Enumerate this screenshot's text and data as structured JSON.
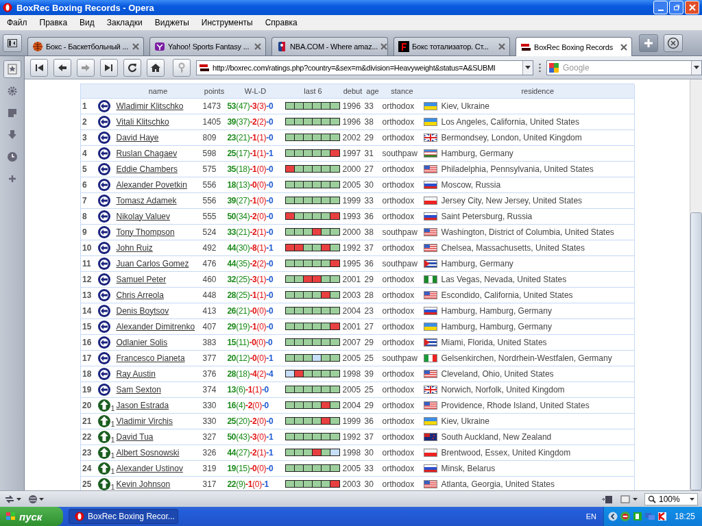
{
  "window": {
    "title": "BoxRec Boxing Records - Opera"
  },
  "menu": [
    "Файл",
    "Правка",
    "Вид",
    "Закладки",
    "Виджеты",
    "Инструменты",
    "Справка"
  ],
  "tabs": [
    {
      "label": "Бокс - Баскетбольный ...",
      "kind": "ball",
      "selected": false
    },
    {
      "label": "Yahoo! Sports Fantasy ...",
      "kind": "yahoo",
      "selected": false
    },
    {
      "label": "NBA.COM - Where amaz...",
      "kind": "nba",
      "selected": false
    },
    {
      "label": "Бокс тотализатор. Ст...",
      "kind": "f",
      "selected": false
    },
    {
      "label": "BoxRec Boxing Records",
      "kind": "boxrec",
      "selected": true
    }
  ],
  "address": {
    "value": "http://boxrec.com/ratings.php?country=&sex=m&division=Heavyweight&status=A&SUBMI"
  },
  "search": {
    "placeholder": "Google"
  },
  "table": {
    "columns": [
      "name",
      "points",
      "W-L-D",
      "last 6",
      "debut",
      "age",
      "stance",
      "residence"
    ],
    "rows": [
      {
        "rank": "1",
        "trend": {
          "kind": "same"
        },
        "name": "Wladimir Klitschko",
        "points": "1473",
        "wins": "53",
        "wins_ko": "(47)",
        "losses": "-3",
        "losses_ko": "(3)",
        "draws": "-0",
        "last6": [
          {
            "kind": "win"
          },
          {
            "kind": "win"
          },
          {
            "kind": "win"
          },
          {
            "kind": "win"
          },
          {
            "kind": "win"
          },
          {
            "kind": "win"
          }
        ],
        "debut": "1996",
        "age": "33",
        "stance": "orthodox",
        "flag": {
          "kind": "ua"
        },
        "residence": "Kiev, Ukraine"
      },
      {
        "rank": "2",
        "trend": {
          "kind": "same"
        },
        "name": "Vitali Klitschko",
        "points": "1405",
        "wins": "39",
        "wins_ko": "(37)",
        "losses": "-2",
        "losses_ko": "(2)",
        "draws": "-0",
        "last6": [
          {
            "kind": "win"
          },
          {
            "kind": "win"
          },
          {
            "kind": "win"
          },
          {
            "kind": "win"
          },
          {
            "kind": "win"
          },
          {
            "kind": "win"
          }
        ],
        "debut": "1996",
        "age": "38",
        "stance": "orthodox",
        "flag": {
          "kind": "ua"
        },
        "residence": "Los Angeles, California, United States"
      },
      {
        "rank": "3",
        "trend": {
          "kind": "same"
        },
        "name": "David Haye",
        "points": "809",
        "wins": "23",
        "wins_ko": "(21)",
        "losses": "-1",
        "losses_ko": "(1)",
        "draws": "-0",
        "last6": [
          {
            "kind": "win"
          },
          {
            "kind": "win"
          },
          {
            "kind": "win"
          },
          {
            "kind": "win"
          },
          {
            "kind": "win"
          },
          {
            "kind": "win"
          }
        ],
        "debut": "2002",
        "age": "29",
        "stance": "orthodox",
        "flag": {
          "kind": "gb"
        },
        "residence": "Bermondsey, London, United Kingdom"
      },
      {
        "rank": "4",
        "trend": {
          "kind": "same"
        },
        "name": "Ruslan Chagaev",
        "points": "598",
        "wins": "25",
        "wins_ko": "(17)",
        "losses": "-1",
        "losses_ko": "(1)",
        "draws": "-1",
        "last6": [
          {
            "kind": "win"
          },
          {
            "kind": "win"
          },
          {
            "kind": "win"
          },
          {
            "kind": "win"
          },
          {
            "kind": "win"
          },
          {
            "kind": "loss"
          }
        ],
        "debut": "1997",
        "age": "31",
        "stance": "southpaw",
        "flag": {
          "kind": "uz"
        },
        "residence": "Hamburg, Germany"
      },
      {
        "rank": "5",
        "trend": {
          "kind": "same"
        },
        "name": "Eddie Chambers",
        "points": "575",
        "wins": "35",
        "wins_ko": "(18)",
        "losses": "-1",
        "losses_ko": "(0)",
        "draws": "-0",
        "last6": [
          {
            "kind": "loss"
          },
          {
            "kind": "win"
          },
          {
            "kind": "win"
          },
          {
            "kind": "win"
          },
          {
            "kind": "win"
          },
          {
            "kind": "win"
          }
        ],
        "debut": "2000",
        "age": "27",
        "stance": "orthodox",
        "flag": {
          "kind": "us"
        },
        "residence": "Philadelphia, Pennsylvania, United States"
      },
      {
        "rank": "6",
        "trend": {
          "kind": "same"
        },
        "name": "Alexander Povetkin",
        "points": "556",
        "wins": "18",
        "wins_ko": "(13)",
        "losses": "-0",
        "losses_ko": "(0)",
        "draws": "-0",
        "last6": [
          {
            "kind": "win"
          },
          {
            "kind": "win"
          },
          {
            "kind": "win"
          },
          {
            "kind": "win"
          },
          {
            "kind": "win"
          },
          {
            "kind": "win"
          }
        ],
        "debut": "2005",
        "age": "30",
        "stance": "orthodox",
        "flag": {
          "kind": "ru"
        },
        "residence": "Moscow, Russia"
      },
      {
        "rank": "7",
        "trend": {
          "kind": "same"
        },
        "name": "Tomasz Adamek",
        "points": "556",
        "wins": "39",
        "wins_ko": "(27)",
        "losses": "-1",
        "losses_ko": "(0)",
        "draws": "-0",
        "last6": [
          {
            "kind": "win"
          },
          {
            "kind": "win"
          },
          {
            "kind": "win"
          },
          {
            "kind": "win"
          },
          {
            "kind": "win"
          },
          {
            "kind": "win"
          }
        ],
        "debut": "1999",
        "age": "33",
        "stance": "orthodox",
        "flag": {
          "kind": "pl"
        },
        "residence": "Jersey City, New Jersey, United States"
      },
      {
        "rank": "8",
        "trend": {
          "kind": "same"
        },
        "name": "Nikolay Valuev",
        "points": "555",
        "wins": "50",
        "wins_ko": "(34)",
        "losses": "-2",
        "losses_ko": "(0)",
        "draws": "-0",
        "last6": [
          {
            "kind": "loss"
          },
          {
            "kind": "win"
          },
          {
            "kind": "win"
          },
          {
            "kind": "win"
          },
          {
            "kind": "win"
          },
          {
            "kind": "loss"
          }
        ],
        "debut": "1993",
        "age": "36",
        "stance": "orthodox",
        "flag": {
          "kind": "ru"
        },
        "residence": "Saint Petersburg, Russia"
      },
      {
        "rank": "9",
        "trend": {
          "kind": "same"
        },
        "name": "Tony Thompson",
        "points": "524",
        "wins": "33",
        "wins_ko": "(21)",
        "losses": "-2",
        "losses_ko": "(1)",
        "draws": "-0",
        "last6": [
          {
            "kind": "win"
          },
          {
            "kind": "win"
          },
          {
            "kind": "win"
          },
          {
            "kind": "loss"
          },
          {
            "kind": "win"
          },
          {
            "kind": "win"
          }
        ],
        "debut": "2000",
        "age": "38",
        "stance": "southpaw",
        "flag": {
          "kind": "us"
        },
        "residence": "Washington, District of Columbia, United States"
      },
      {
        "rank": "10",
        "trend": {
          "kind": "same"
        },
        "name": "John Ruiz",
        "points": "492",
        "wins": "44",
        "wins_ko": "(30)",
        "losses": "-8",
        "losses_ko": "(1)",
        "draws": "-1",
        "last6": [
          {
            "kind": "loss"
          },
          {
            "kind": "loss"
          },
          {
            "kind": "win"
          },
          {
            "kind": "win"
          },
          {
            "kind": "loss"
          },
          {
            "kind": "win"
          }
        ],
        "debut": "1992",
        "age": "37",
        "stance": "orthodox",
        "flag": {
          "kind": "us"
        },
        "residence": "Chelsea, Massachusetts, United States"
      },
      {
        "rank": "11",
        "trend": {
          "kind": "same"
        },
        "name": "Juan Carlos Gomez",
        "points": "476",
        "wins": "44",
        "wins_ko": "(35)",
        "losses": "-2",
        "losses_ko": "(2)",
        "draws": "-0",
        "last6": [
          {
            "kind": "win"
          },
          {
            "kind": "win"
          },
          {
            "kind": "win"
          },
          {
            "kind": "win"
          },
          {
            "kind": "win"
          },
          {
            "kind": "loss"
          }
        ],
        "debut": "1995",
        "age": "36",
        "stance": "southpaw",
        "flag": {
          "kind": "cu"
        },
        "residence": "Hamburg, Germany"
      },
      {
        "rank": "12",
        "trend": {
          "kind": "same"
        },
        "name": "Samuel Peter",
        "points": "460",
        "wins": "32",
        "wins_ko": "(25)",
        "losses": "-3",
        "losses_ko": "(1)",
        "draws": "-0",
        "last6": [
          {
            "kind": "win"
          },
          {
            "kind": "win"
          },
          {
            "kind": "loss"
          },
          {
            "kind": "loss"
          },
          {
            "kind": "win"
          },
          {
            "kind": "win"
          }
        ],
        "debut": "2001",
        "age": "29",
        "stance": "orthodox",
        "flag": {
          "kind": "ng"
        },
        "residence": "Las Vegas, Nevada, United States"
      },
      {
        "rank": "13",
        "trend": {
          "kind": "same"
        },
        "name": "Chris Arreola",
        "points": "448",
        "wins": "28",
        "wins_ko": "(25)",
        "losses": "-1",
        "losses_ko": "(1)",
        "draws": "-0",
        "last6": [
          {
            "kind": "win"
          },
          {
            "kind": "win"
          },
          {
            "kind": "win"
          },
          {
            "kind": "win"
          },
          {
            "kind": "loss"
          },
          {
            "kind": "win"
          }
        ],
        "debut": "2003",
        "age": "28",
        "stance": "orthodox",
        "flag": {
          "kind": "us"
        },
        "residence": "Escondido, California, United States"
      },
      {
        "rank": "14",
        "trend": {
          "kind": "same"
        },
        "name": "Denis Boytsov",
        "points": "413",
        "wins": "26",
        "wins_ko": "(21)",
        "losses": "-0",
        "losses_ko": "(0)",
        "draws": "-0",
        "last6": [
          {
            "kind": "win"
          },
          {
            "kind": "win"
          },
          {
            "kind": "win"
          },
          {
            "kind": "win"
          },
          {
            "kind": "win"
          },
          {
            "kind": "win"
          }
        ],
        "debut": "2004",
        "age": "23",
        "stance": "orthodox",
        "flag": {
          "kind": "ru"
        },
        "residence": "Hamburg, Hamburg, Germany"
      },
      {
        "rank": "15",
        "trend": {
          "kind": "same"
        },
        "name": "Alexander Dimitrenko",
        "points": "407",
        "wins": "29",
        "wins_ko": "(19)",
        "losses": "-1",
        "losses_ko": "(0)",
        "draws": "-0",
        "last6": [
          {
            "kind": "win"
          },
          {
            "kind": "win"
          },
          {
            "kind": "win"
          },
          {
            "kind": "win"
          },
          {
            "kind": "win"
          },
          {
            "kind": "loss"
          }
        ],
        "debut": "2001",
        "age": "27",
        "stance": "orthodox",
        "flag": {
          "kind": "ua"
        },
        "residence": "Hamburg, Hamburg, Germany"
      },
      {
        "rank": "16",
        "trend": {
          "kind": "same"
        },
        "name": "Odlanier Solis",
        "points": "383",
        "wins": "15",
        "wins_ko": "(11)",
        "losses": "-0",
        "losses_ko": "(0)",
        "draws": "-0",
        "last6": [
          {
            "kind": "win"
          },
          {
            "kind": "win"
          },
          {
            "kind": "win"
          },
          {
            "kind": "win"
          },
          {
            "kind": "win"
          },
          {
            "kind": "win"
          }
        ],
        "debut": "2007",
        "age": "29",
        "stance": "orthodox",
        "flag": {
          "kind": "cu"
        },
        "residence": "Miami, Florida, United States"
      },
      {
        "rank": "17",
        "trend": {
          "kind": "same"
        },
        "name": "Francesco Pianeta",
        "points": "377",
        "wins": "20",
        "wins_ko": "(12)",
        "losses": "-0",
        "losses_ko": "(0)",
        "draws": "-1",
        "last6": [
          {
            "kind": "win"
          },
          {
            "kind": "win"
          },
          {
            "kind": "win"
          },
          {
            "kind": "draw"
          },
          {
            "kind": "win"
          },
          {
            "kind": "win"
          }
        ],
        "debut": "2005",
        "age": "25",
        "stance": "southpaw",
        "flag": {
          "kind": "it"
        },
        "residence": "Gelsenkirchen, Nordrhein-Westfalen, Germany"
      },
      {
        "rank": "18",
        "trend": {
          "kind": "same"
        },
        "name": "Ray Austin",
        "points": "376",
        "wins": "28",
        "wins_ko": "(18)",
        "losses": "-4",
        "losses_ko": "(2)",
        "draws": "-4",
        "last6": [
          {
            "kind": "draw"
          },
          {
            "kind": "loss"
          },
          {
            "kind": "win"
          },
          {
            "kind": "win"
          },
          {
            "kind": "win"
          },
          {
            "kind": "win"
          }
        ],
        "debut": "1998",
        "age": "39",
        "stance": "orthodox",
        "flag": {
          "kind": "us"
        },
        "residence": "Cleveland, Ohio, United States"
      },
      {
        "rank": "19",
        "trend": {
          "kind": "same"
        },
        "name": "Sam Sexton",
        "points": "374",
        "wins": "13",
        "wins_ko": "(6)",
        "losses": "-1",
        "losses_ko": "(1)",
        "draws": "-0",
        "last6": [
          {
            "kind": "win"
          },
          {
            "kind": "win"
          },
          {
            "kind": "win"
          },
          {
            "kind": "win"
          },
          {
            "kind": "win"
          },
          {
            "kind": "win"
          }
        ],
        "debut": "2005",
        "age": "25",
        "stance": "orthodox",
        "flag": {
          "kind": "gb"
        },
        "residence": "Norwich, Norfolk, United Kingdom"
      },
      {
        "rank": "20",
        "trend": {
          "kind": "up",
          "change": "1"
        },
        "name": "Jason Estrada",
        "points": "330",
        "wins": "16",
        "wins_ko": "(4)",
        "losses": "-2",
        "losses_ko": "(0)",
        "draws": "-0",
        "last6": [
          {
            "kind": "win"
          },
          {
            "kind": "win"
          },
          {
            "kind": "win"
          },
          {
            "kind": "win"
          },
          {
            "kind": "loss"
          },
          {
            "kind": "win"
          }
        ],
        "debut": "2004",
        "age": "29",
        "stance": "orthodox",
        "flag": {
          "kind": "us"
        },
        "residence": "Providence, Rhode Island, United States"
      },
      {
        "rank": "21",
        "trend": {
          "kind": "up",
          "change": "1"
        },
        "name": "Vladimir Virchis",
        "points": "330",
        "wins": "25",
        "wins_ko": "(20)",
        "losses": "-2",
        "losses_ko": "(0)",
        "draws": "-0",
        "last6": [
          {
            "kind": "win"
          },
          {
            "kind": "win"
          },
          {
            "kind": "win"
          },
          {
            "kind": "win"
          },
          {
            "kind": "loss"
          },
          {
            "kind": "win"
          }
        ],
        "debut": "1999",
        "age": "36",
        "stance": "orthodox",
        "flag": {
          "kind": "ua"
        },
        "residence": "Kiev, Ukraine"
      },
      {
        "rank": "22",
        "trend": {
          "kind": "up",
          "change": "1"
        },
        "name": "David Tua",
        "points": "327",
        "wins": "50",
        "wins_ko": "(43)",
        "losses": "-3",
        "losses_ko": "(0)",
        "draws": "-1",
        "last6": [
          {
            "kind": "win"
          },
          {
            "kind": "win"
          },
          {
            "kind": "win"
          },
          {
            "kind": "win"
          },
          {
            "kind": "win"
          },
          {
            "kind": "win"
          }
        ],
        "debut": "1992",
        "age": "37",
        "stance": "orthodox",
        "flag": {
          "kind": "nz"
        },
        "residence": "South Auckland, New Zealand"
      },
      {
        "rank": "23",
        "trend": {
          "kind": "up",
          "change": "1"
        },
        "name": "Albert Sosnowski",
        "points": "326",
        "wins": "44",
        "wins_ko": "(27)",
        "losses": "-2",
        "losses_ko": "(1)",
        "draws": "-1",
        "last6": [
          {
            "kind": "win"
          },
          {
            "kind": "win"
          },
          {
            "kind": "win"
          },
          {
            "kind": "loss"
          },
          {
            "kind": "win"
          },
          {
            "kind": "draw"
          }
        ],
        "debut": "1998",
        "age": "30",
        "stance": "orthodox",
        "flag": {
          "kind": "pl"
        },
        "residence": "Brentwood, Essex, United Kingdom"
      },
      {
        "rank": "24",
        "trend": {
          "kind": "up",
          "change": "1"
        },
        "name": "Alexander Ustinov",
        "points": "319",
        "wins": "19",
        "wins_ko": "(15)",
        "losses": "-0",
        "losses_ko": "(0)",
        "draws": "-0",
        "last6": [
          {
            "kind": "win"
          },
          {
            "kind": "win"
          },
          {
            "kind": "win"
          },
          {
            "kind": "win"
          },
          {
            "kind": "win"
          },
          {
            "kind": "win"
          }
        ],
        "debut": "2005",
        "age": "33",
        "stance": "orthodox",
        "flag": {
          "kind": "ru"
        },
        "residence": "Minsk, Belarus"
      },
      {
        "rank": "25",
        "trend": {
          "kind": "up",
          "change": "1"
        },
        "name": "Kevin Johnson",
        "points": "317",
        "wins": "22",
        "wins_ko": "(9)",
        "losses": "-1",
        "losses_ko": "(0)",
        "draws": "-1",
        "last6": [
          {
            "kind": "win"
          },
          {
            "kind": "win"
          },
          {
            "kind": "win"
          },
          {
            "kind": "win"
          },
          {
            "kind": "win"
          },
          {
            "kind": "loss"
          }
        ],
        "debut": "2003",
        "age": "30",
        "stance": "orthodox",
        "flag": {
          "kind": "us"
        },
        "residence": "Atlanta, Georgia, United States"
      }
    ]
  },
  "status_bar": {
    "zoom": "100%"
  },
  "taskbar": {
    "start": "пуск",
    "task": "BoxRec Boxing Recor...",
    "language": "EN",
    "clock": "18:25"
  }
}
